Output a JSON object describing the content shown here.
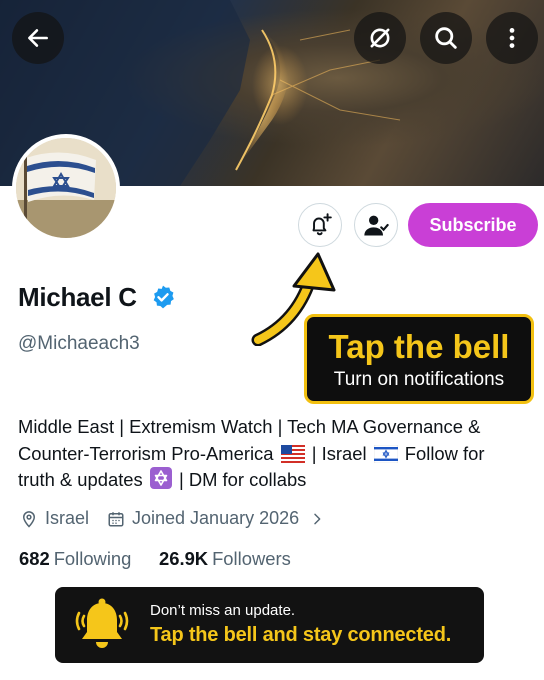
{
  "profile": {
    "name": "Michael C",
    "handle": "@Michaeach3",
    "bio_part1": "Middle East | Extremism Watch | Tech MA Governance & Counter-Terrorism Pro-America ",
    "bio_part2": " | Israel ",
    "bio_part3": " Follow for truth & updates ",
    "bio_part4": " | DM for collabs",
    "location": "Israel",
    "joined": "Joined January 2026",
    "following_count": "682",
    "following_label": "Following",
    "followers_count": "26.9K",
    "followers_label": "Followers"
  },
  "actions": {
    "subscribe_label": "Subscribe"
  },
  "callout": {
    "title": "Tap the bell",
    "subtitle": "Turn on notifications"
  },
  "toast": {
    "line1": "Don’t miss an update.",
    "line2": "Tap the bell and stay connected."
  },
  "icons": {
    "back": "arrow-left-icon",
    "sync": "sync-off-icon",
    "search": "search-icon",
    "more": "more-vertical-icon",
    "bell": "bell-plus-icon",
    "follow": "user-check-icon",
    "verified": "verified-badge-icon",
    "location": "location-pin-icon",
    "calendar": "calendar-icon"
  },
  "colors": {
    "subscribe": "#c93fd6",
    "accent_yellow": "#f5c61a",
    "verified_blue": "#1d9bf0",
    "secondary_text": "#536471"
  }
}
